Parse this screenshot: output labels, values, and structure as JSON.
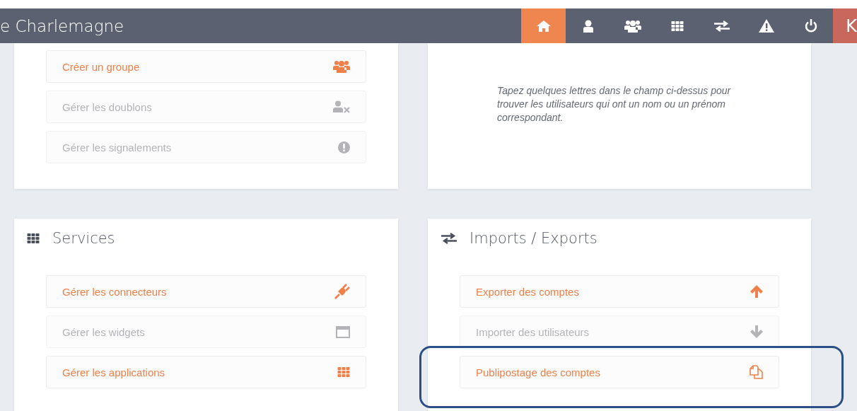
{
  "header": {
    "title": "e Charlemagne",
    "nav": [
      {
        "selected": true
      },
      {
        "selected": false
      },
      {
        "selected": false
      },
      {
        "selected": false
      },
      {
        "selected": false
      },
      {
        "selected": false
      },
      {
        "selected": false
      }
    ],
    "user_initial": "K"
  },
  "panels": [
    {
      "items": [
        {
          "label": "Créer un groupe",
          "disabled": false,
          "highlighted": false
        },
        {
          "label": "Gérer les doublons",
          "disabled": true,
          "highlighted": false
        },
        {
          "label": "Gérer les signalements",
          "disabled": true,
          "highlighted": false
        }
      ]
    },
    {
      "hint": "Tapez quelques lettres dans le champ ci-dessus pour trouver les utilisateurs qui ont un nom ou un prénom correspondant."
    },
    {
      "title": "Services",
      "items": [
        {
          "label": "Gérer les connecteurs",
          "disabled": false,
          "highlighted": false
        },
        {
          "label": "Gérer les widgets",
          "disabled": true,
          "highlighted": false
        },
        {
          "label": "Gérer les applications",
          "disabled": false,
          "highlighted": false
        }
      ]
    },
    {
      "title": "Imports / Exports",
      "items": [
        {
          "label": "Exporter des comptes",
          "disabled": false,
          "highlighted": false
        },
        {
          "label": "Importer des utilisateurs",
          "disabled": true,
          "highlighted": false
        },
        {
          "label": "Publipostage des comptes",
          "disabled": false,
          "highlighted": true
        }
      ]
    }
  ]
}
